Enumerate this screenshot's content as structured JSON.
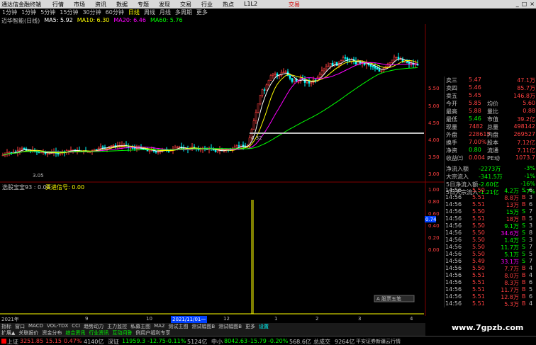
{
  "topbar": {
    "app_title": "通达信金融终端",
    "menu": [
      "行情",
      "市场",
      "资讯",
      "数据",
      "专题",
      "发现",
      "交易",
      "行业",
      "热点",
      "L1L2"
    ],
    "trade_label": "交易",
    "window_buttons": [
      "_",
      "□",
      "×"
    ]
  },
  "periods": {
    "items": [
      "1分钟",
      "1分钟",
      "5分钟",
      "15分钟",
      "30分钟",
      "60分钟",
      "日线",
      "周线",
      "月线",
      "多周期",
      "更多"
    ],
    "active_index": 6
  },
  "legend": {
    "stock": "迈华智能(日线)",
    "ma5": "MA5: 5.92",
    "ma10": "MA10: 6.30",
    "ma20": "MA20: 6.46",
    "ma60": "MA60: 5.76"
  },
  "colors": {
    "ma5": "#ffffff",
    "ma10": "#ffff00",
    "ma20": "#ff00ff",
    "ma60": "#00ff00",
    "up": "#ff4040",
    "down": "#00ffff",
    "yellow": "#ffff00"
  },
  "price_axis_labels": [
    "5.50",
    "5.00",
    "4.50",
    "4.00",
    "3.50",
    "3.00"
  ],
  "annotations": {
    "low": "3.05",
    "line_level": "4.32"
  },
  "indicator": {
    "title": "选股宝宝93 : 0.00",
    "signal": "买进信号: 0.00",
    "axis": [
      "1.00",
      "0.80",
      "0.60",
      "0.40",
      "0.20",
      "0.00"
    ],
    "side_value": "0.74"
  },
  "quote": {
    "rows": [
      {
        "k": "卖三",
        "v": "5.47",
        "v2": "47.1万"
      },
      {
        "k": "卖四",
        "v": "5.46",
        "v2": "85.7万"
      },
      {
        "k": "卖五",
        "v": "5.45",
        "v2": "146.8万"
      },
      {
        "k": "今开",
        "v": "5.85",
        "k2": "均价",
        "v2": "5.60"
      },
      {
        "k": "最高",
        "v": "5.88",
        "k2": "量比",
        "v2": "0.88"
      },
      {
        "k": "最低",
        "v": "5.46",
        "k2": "市值",
        "v2": "39.2亿"
      },
      {
        "k": "现量",
        "v": "7482",
        "k2": "总量",
        "v2": "498142"
      },
      {
        "k": "外盘",
        "v": "228615",
        "k2": "内盘",
        "v2": "269527"
      },
      {
        "k": "换手",
        "v": "7.00%",
        "k2": "股本",
        "v2": "7.12亿"
      },
      {
        "k": "净资",
        "v": "0.80",
        "k2": "流通",
        "v2": "7.11亿"
      },
      {
        "k": "收益㈢",
        "v": "0.004",
        "k2": "PE动",
        "v2": "1073.7"
      },
      {
        "k": "净流入额",
        "v": "-2273万",
        "v2": "-3%"
      },
      {
        "k": "大宗流入",
        "v": "-341.5万",
        "v2": "-1%"
      },
      {
        "k": "5日净流入额",
        "v": "-2.60亿",
        "v2": "-16%"
      },
      {
        "k": "5日大宗流入",
        "v": "-1.21亿",
        "v2": "-7%"
      }
    ]
  },
  "trades": [
    {
      "t": "14:56",
      "p": "5.50",
      "q": "4.2万",
      "d": "S",
      "n": "6"
    },
    {
      "t": "14:56",
      "p": "5.51",
      "q": "8.8万",
      "d": "B",
      "n": "3"
    },
    {
      "t": "14:56",
      "p": "5.51",
      "q": "13万",
      "d": "B",
      "n": "6"
    },
    {
      "t": "14:56",
      "p": "5.50",
      "q": "15万",
      "d": "S",
      "n": "7"
    },
    {
      "t": "14:56",
      "p": "5.51",
      "q": "18万",
      "d": "B",
      "n": "5"
    },
    {
      "t": "14:56",
      "p": "5.50",
      "q": "9.1万",
      "d": "S",
      "n": "3"
    },
    {
      "t": "14:56",
      "p": "5.50",
      "q": "34.6万",
      "d": "S",
      "n": "8"
    },
    {
      "t": "14:56",
      "p": "5.50",
      "q": "1.4万",
      "d": "S",
      "n": "3"
    },
    {
      "t": "14:56",
      "p": "5.50",
      "q": "11.7万",
      "d": "S",
      "n": "7"
    },
    {
      "t": "14:56",
      "p": "5.50",
      "q": "5.1万",
      "d": "S",
      "n": "5"
    },
    {
      "t": "14:56",
      "p": "5.49",
      "q": "33.1万",
      "d": "S",
      "n": "7"
    },
    {
      "t": "14:56",
      "p": "5.50",
      "q": "7.7万",
      "d": "B",
      "n": "4"
    },
    {
      "t": "14:56",
      "p": "5.51",
      "q": "8.0万",
      "d": "B",
      "n": "4"
    },
    {
      "t": "14:56",
      "p": "5.51",
      "q": "8.3万",
      "d": "B",
      "n": "6"
    },
    {
      "t": "14:56",
      "p": "5.51",
      "q": "11.7万",
      "d": "B",
      "n": "5"
    },
    {
      "t": "14:56",
      "p": "5.51",
      "q": "12.8万",
      "d": "B",
      "n": "6"
    },
    {
      "t": "14:56",
      "p": "5.51",
      "q": "5.3万",
      "d": "B",
      "n": "4"
    }
  ],
  "date_axis": {
    "start": "2021年",
    "labels": [
      "9",
      "10",
      "11",
      "2021/11/01一",
      "12",
      "1",
      "2",
      "3",
      "4"
    ]
  },
  "tabs": [
    "指标",
    "窗口",
    "MACD",
    "VOL-TDX",
    "CCI",
    "趋势动力",
    "主力监控",
    "私募主图",
    "MA2",
    "测试主图",
    "测试幅图B",
    "测试幅图B",
    "更多",
    "设置"
  ],
  "tabs2": [
    "扩展▲",
    "关联报价",
    "资金分布",
    "综合资讯",
    "行业资讯",
    "互动问答",
    "例用户福利专享"
  ],
  "status": {
    "sh_label": "上证",
    "sh_val": "3251.85",
    "sh_chg": "15.15",
    "sh_pct": "0.47%",
    "sh_amt": "4140亿",
    "sz_label": "深证",
    "sz_val": "11959.3",
    "sz_chg": "-12.75",
    "sz_pct": "-0.11%",
    "sz_amt": "5124亿",
    "zx_label": "中小",
    "zx_val": "8042.63",
    "zx_chg": "-15.79",
    "zx_pct": "-0.20%",
    "zx_amt": "568.6亿",
    "total_label": "总成交",
    "total_amt": "9264亿",
    "broker": "平安证券新疆云行情"
  },
  "buttons": {
    "zoom_label": "A 股票五笔"
  },
  "watermark": "www.7gpzb.com"
}
